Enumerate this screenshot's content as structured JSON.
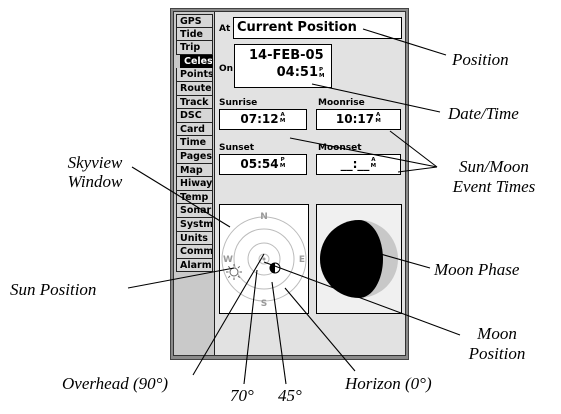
{
  "tabs": [
    "GPS",
    "Tide",
    "Trip",
    "Celes",
    "Points",
    "Route",
    "Track",
    "DSC",
    "Card",
    "Time",
    "Pages",
    "Map",
    "Hiway",
    "Temp",
    "Sonar",
    "Systm",
    "Units",
    "Comm",
    "Alarm"
  ],
  "selected_tab": "Celes",
  "position": {
    "label": "At",
    "value": "Current Position"
  },
  "datetime": {
    "label": "On",
    "date": "14-FEB-05",
    "time": "04:51",
    "ampm": "PM"
  },
  "sunrise": {
    "label": "Sunrise",
    "time": "07:12",
    "ampm": "AM"
  },
  "moonrise": {
    "label": "Moonrise",
    "time": "10:17",
    "ampm": "AM"
  },
  "sunset": {
    "label": "Sunset",
    "time": "05:54",
    "ampm": "PM"
  },
  "moonset": {
    "label": "Moonset",
    "time": "__:__",
    "ampm": "AM"
  },
  "skyview": {
    "north": "N",
    "east": "E",
    "south": "S",
    "west": "W"
  },
  "callouts": {
    "position": "Position",
    "datetime": "Date/Time",
    "events_line1": "Sun/Moon",
    "events_line2": "Event Times",
    "skyview_line1": "Skyview",
    "skyview_line2": "Window",
    "moon_phase": "Moon Phase",
    "sun_position": "Sun Position",
    "moon_position_line1": "Moon",
    "moon_position_line2": "Position",
    "overhead": "Overhead (90°)",
    "deg70": "70°",
    "deg45": "45°",
    "horizon": "Horizon (0°)"
  },
  "colors": {
    "screen_bg": "#c9c9c9",
    "field_bg": "#ffffff",
    "moon_dark": "#000000",
    "moon_lit": "#c8c8c8"
  }
}
